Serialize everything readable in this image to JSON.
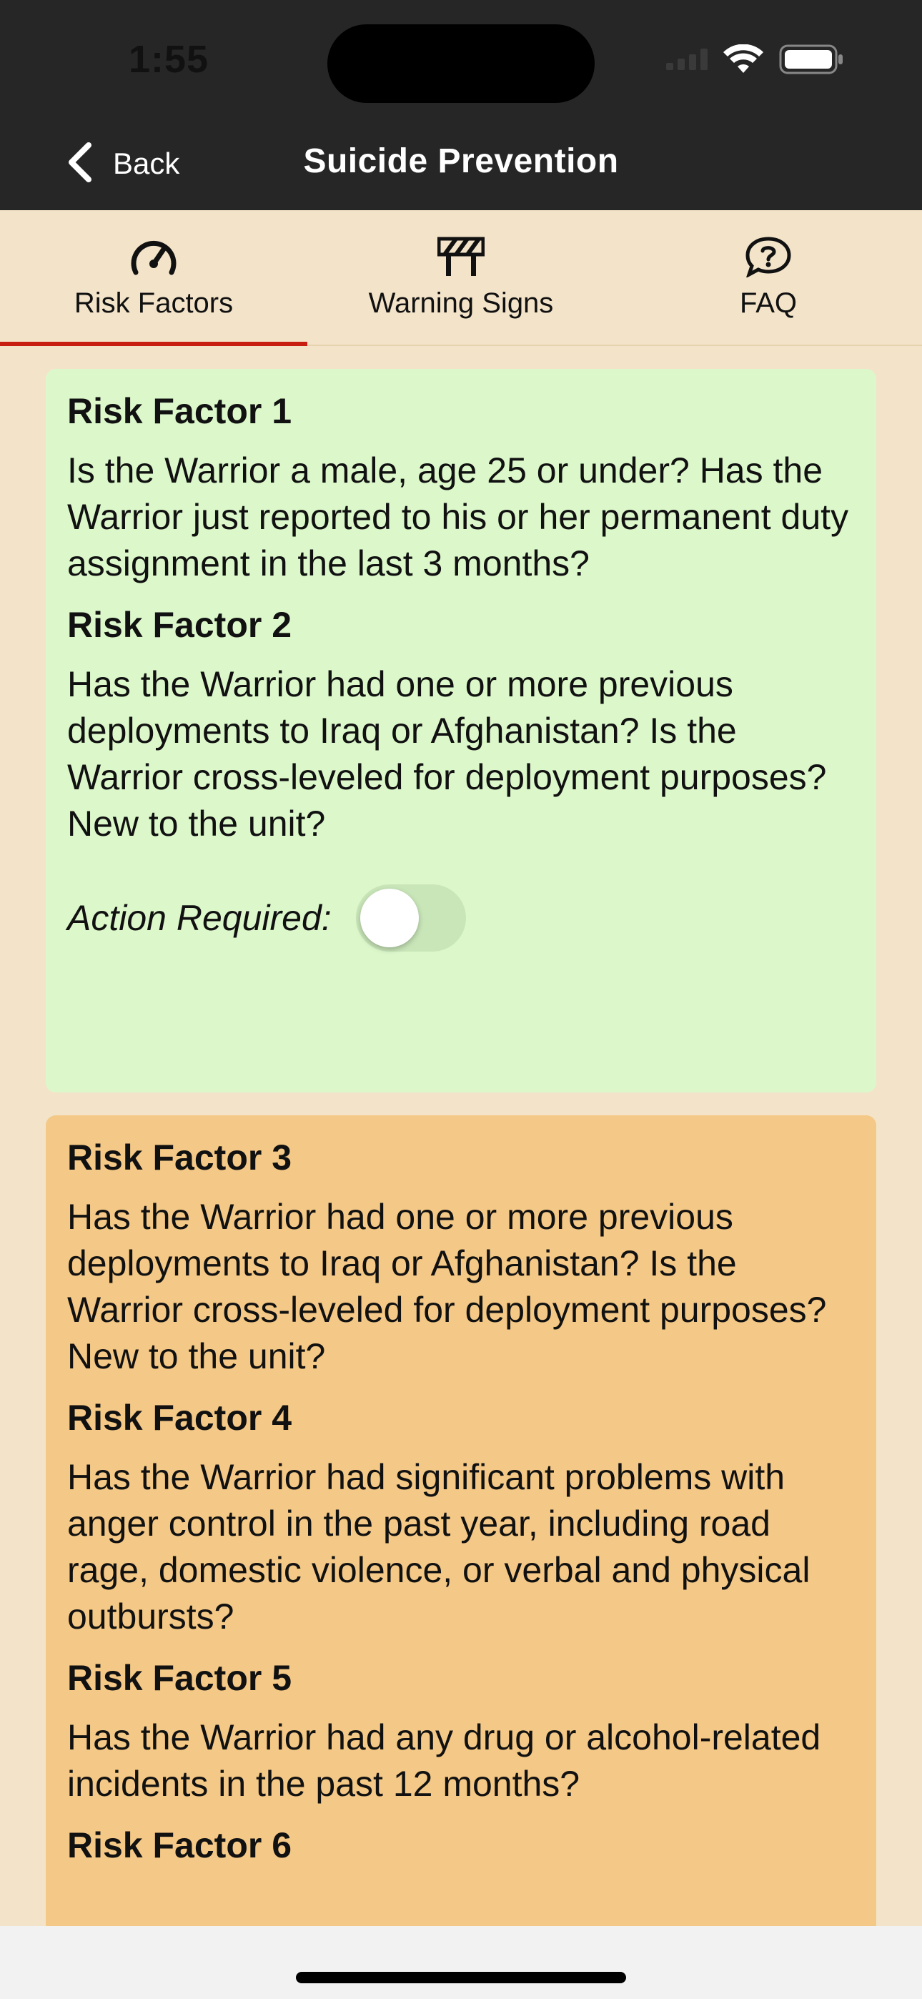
{
  "status_bar": {
    "time": "1:55",
    "icons": [
      "signal-icon",
      "wifi-icon",
      "battery-icon"
    ]
  },
  "nav": {
    "back_label": "Back",
    "title": "Suicide Prevention",
    "back_icon": "chevron-left-icon"
  },
  "tabs": [
    {
      "label": "Risk Factors",
      "icon": "gauge-icon",
      "selected": true
    },
    {
      "label": "Warning Signs",
      "icon": "barrier-icon",
      "selected": false
    },
    {
      "label": "FAQ",
      "icon": "question-bubble-icon",
      "selected": false
    }
  ],
  "colors": {
    "accent": "#c81e12",
    "nav_background": "#262626",
    "page_background": "#f3e4c9",
    "low_risk_card": "#dcf8cb",
    "medium_risk_card": "#f4c886"
  },
  "cards": [
    {
      "items": [
        {
          "title": "Risk Factor 1",
          "text": "Is the Warrior a male, age 25 or under? Has the Warrior just reported to his or her permanent duty assignment in the last 3 months?"
        },
        {
          "title": "Risk Factor 2",
          "text": "Has the Warrior had one or more previous deployments to Iraq or Afghanistan? Is the Warrior cross-leveled for deployment purposes? New to the unit?"
        }
      ],
      "action_label": "Action Required:",
      "action_toggle_on": false
    },
    {
      "items": [
        {
          "title": "Risk Factor 3",
          "text": "Has the Warrior had one or more previous deployments to Iraq or Afghanistan? Is the Warrior cross-leveled for deployment purposes? New to the unit?"
        },
        {
          "title": "Risk Factor 4",
          "text": "Has the Warrior had significant problems with anger control in the past year, including road rage, domestic violence, or verbal and physical outbursts?"
        },
        {
          "title": "Risk Factor 5",
          "text": "Has the Warrior had any drug or alcohol-related incidents in the past 12 months?"
        },
        {
          "title": "Risk Factor 6",
          "text": ""
        }
      ]
    }
  ]
}
